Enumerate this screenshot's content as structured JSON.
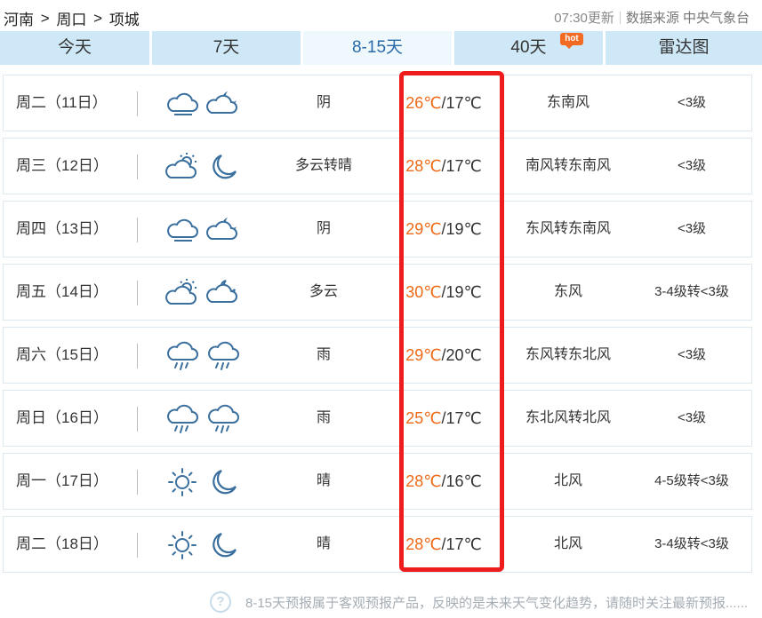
{
  "breadcrumb": {
    "province": "河南",
    "city": "周口",
    "county": "项城",
    "separator": ">"
  },
  "source": {
    "time": "07:30更新",
    "text": "数据来源 中央气象台"
  },
  "tabs": [
    {
      "label": "今天",
      "active": false
    },
    {
      "label": "7天",
      "active": false
    },
    {
      "label": "8-15天",
      "active": true
    },
    {
      "label": "40天",
      "active": false,
      "badge": "hot"
    },
    {
      "label": "雷达图",
      "active": false
    }
  ],
  "days": [
    {
      "day": "周二（11日）",
      "icon_day": "cloudy-icon",
      "icon_night": "cloudy-night-icon",
      "condition": "阴",
      "high": "26℃",
      "low": "/17℃",
      "wind": "东南风",
      "level": "<3级"
    },
    {
      "day": "周三（12日）",
      "icon_day": "partly-cloudy-icon",
      "icon_night": "moon-icon",
      "condition": "多云转晴",
      "high": "28℃",
      "low": "/17℃",
      "wind": "南风转东南风",
      "level": "<3级"
    },
    {
      "day": "周四（13日）",
      "icon_day": "cloudy-icon",
      "icon_night": "cloudy-night-icon",
      "condition": "阴",
      "high": "29℃",
      "low": "/19℃",
      "wind": "东风转东南风",
      "level": "<3级"
    },
    {
      "day": "周五（14日）",
      "icon_day": "partly-cloudy-icon",
      "icon_night": "partly-cloudy-night-icon",
      "condition": "多云",
      "high": "30℃",
      "low": "/19℃",
      "wind": "东风",
      "level": "3-4级转<3级"
    },
    {
      "day": "周六（15日）",
      "icon_day": "rain-icon",
      "icon_night": "rain-icon",
      "condition": "雨",
      "high": "29℃",
      "low": "/20℃",
      "wind": "东风转东北风",
      "level": "<3级"
    },
    {
      "day": "周日（16日）",
      "icon_day": "rain-icon",
      "icon_night": "rain-icon",
      "condition": "雨",
      "high": "25℃",
      "low": "/17℃",
      "wind": "东北风转北风",
      "level": "<3级"
    },
    {
      "day": "周一（17日）",
      "icon_day": "sun-icon",
      "icon_night": "moon-icon",
      "condition": "晴",
      "high": "28℃",
      "low": "/16℃",
      "wind": "北风",
      "level": "4-5级转<3级"
    },
    {
      "day": "周二（18日）",
      "icon_day": "sun-icon",
      "icon_night": "moon-icon",
      "condition": "晴",
      "high": "28℃",
      "low": "/17℃",
      "wind": "北风",
      "level": "3-4级转<3级"
    }
  ],
  "note": {
    "text": "8-15天预报属于客观预报产品，反映的是未来天气变化趋势，请随时关注最新预报......"
  },
  "colors": {
    "tab_bg": "#cfe8f7",
    "tab_active_bg": "#eef8fd",
    "high_temp": "#ee6a16",
    "highlight_box": "#ee1c1c",
    "icon": "#3a6f9e"
  }
}
